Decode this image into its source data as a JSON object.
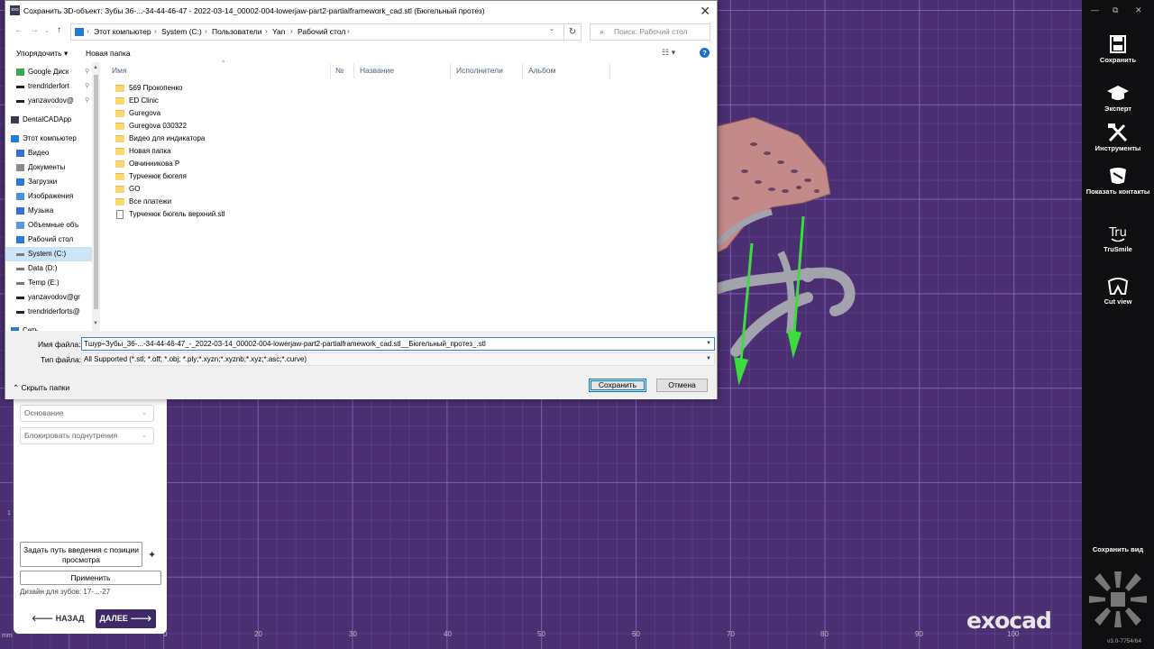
{
  "dialog": {
    "title": "Сохранить 3D-объект: Зубы 36-...-34-44-46-47 - 2022-03-14_00002-004-lowerjaw-part2-partialframework_cad.stl (Бюгельный протез)",
    "app_icon_text": "exo",
    "close": "✕"
  },
  "address_bar": {
    "crumbs": [
      "Этот компьютер",
      "System (C:)",
      "Пользователи",
      "Yan",
      "Рабочий стол"
    ],
    "search_placeholder": "Поиск: Рабочий стол"
  },
  "command_bar": {
    "organize": "Упорядочить ▾",
    "new_folder": "Новая папка",
    "view_options": "☷ ▾"
  },
  "nav_pane": {
    "items": [
      {
        "label": "Google Диск",
        "icon": "google-drive-icon",
        "pin": true
      },
      {
        "label": "trendriderfort",
        "icon": "drive-icon",
        "pin": true
      },
      {
        "label": "yanzavodov@",
        "icon": "drive-icon",
        "pin": true
      },
      {
        "label": "DentalCADApp",
        "icon": "app-icon"
      },
      {
        "label": "Этот компьютер",
        "icon": "computer-icon"
      },
      {
        "label": "Видео",
        "icon": "video-icon"
      },
      {
        "label": "Документы",
        "icon": "documents-icon"
      },
      {
        "label": "Загрузки",
        "icon": "downloads-icon"
      },
      {
        "label": "Изображения",
        "icon": "pictures-icon"
      },
      {
        "label": "Музыка",
        "icon": "music-icon"
      },
      {
        "label": "Объемные объ",
        "icon": "3d-objects-icon"
      },
      {
        "label": "Рабочий стол",
        "icon": "desktop-icon"
      },
      {
        "label": "System (C:)",
        "icon": "disk-icon",
        "selected": true
      },
      {
        "label": "Data (D:)",
        "icon": "disk-icon"
      },
      {
        "label": "Temp (E:)",
        "icon": "disk-icon"
      },
      {
        "label": "yanzavodov@gr",
        "icon": "drive-icon"
      },
      {
        "label": "trendriderforts@",
        "icon": "drive-icon"
      },
      {
        "label": "Сеть",
        "icon": "network-icon"
      }
    ]
  },
  "file_list": {
    "columns": [
      "Имя",
      "№",
      "Название",
      "Исполнители",
      "Альбом"
    ],
    "rows": [
      {
        "name": "569 Прокопенко",
        "type": "folder"
      },
      {
        "name": "ED Clinic",
        "type": "folder"
      },
      {
        "name": "Guregova",
        "type": "folder"
      },
      {
        "name": "Guregova 030322",
        "type": "folder"
      },
      {
        "name": "Видео для индикатора",
        "type": "folder"
      },
      {
        "name": "Новая папка",
        "type": "folder"
      },
      {
        "name": "Овчинникова Р",
        "type": "folder"
      },
      {
        "name": "Турченюк бюгеля",
        "type": "folder"
      },
      {
        "name": "GO",
        "type": "folder"
      },
      {
        "name": "Все платежи",
        "type": "folder"
      },
      {
        "name": "Турченюк бюгель верхний.stl",
        "type": "file"
      }
    ]
  },
  "form": {
    "filename_label": "Имя файла:",
    "filename_value": "Тшур÷Зубы_36-...-34-44-46-47_-_2022-03-14_00002-004-lowerjaw-part2-partialframework_cad.stl__Бюгельный_протез_.stl",
    "filetype_label": "Тип файла:",
    "filetype_value": "All Supported (*.stl; *.off; *.obj; *.ply;*.xyzn;*.xyznb;*.xyz;*.asc;*.curve)",
    "hide_folders": "Скрыть папки",
    "save": "Сохранить",
    "cancel": "Отмена"
  },
  "wizard_panel": {
    "dropdown_base": "Основание",
    "dropdown_block": "Блокировать поднутрения",
    "set_path_button": "Задать путь введения с позиции просмотра",
    "apply_button": "Применить",
    "design_teeth": "Дизайн для зубов: 17-...-27",
    "back": "НАЗАД",
    "next": "ДАЛЕЕ"
  },
  "right_toolbar": {
    "window_controls": [
      "—",
      "⧉",
      "✕"
    ],
    "buttons": [
      {
        "label": "Сохранить",
        "icon": "save-icon"
      },
      {
        "label": "Эксперт",
        "icon": "expert-icon"
      },
      {
        "label": "Инструменты",
        "icon": "tools-icon"
      },
      {
        "label": "Показать контакты",
        "icon": "contacts-icon"
      },
      {
        "label": "TruSmile",
        "icon": "trusmile-icon"
      },
      {
        "label": "Cut view",
        "icon": "cut-view-icon"
      }
    ],
    "save_view": "Сохранить вид",
    "version": "v3.0-7754/64"
  },
  "branding": {
    "logo": "exocad"
  },
  "ruler": {
    "unit": "mm",
    "y_label": "1",
    "ticks": [
      "0",
      "20",
      "30",
      "40",
      "50",
      "60",
      "70",
      "80",
      "90",
      "100"
    ]
  },
  "colors": {
    "viewport_bg": "#4b2f72",
    "toolbar_bg": "#0f0f12",
    "next_button": "#3d2a66",
    "direction_arrow": "#3ddc3d",
    "model_pink": "#c48a8a",
    "model_gray": "#a3a3ad"
  }
}
